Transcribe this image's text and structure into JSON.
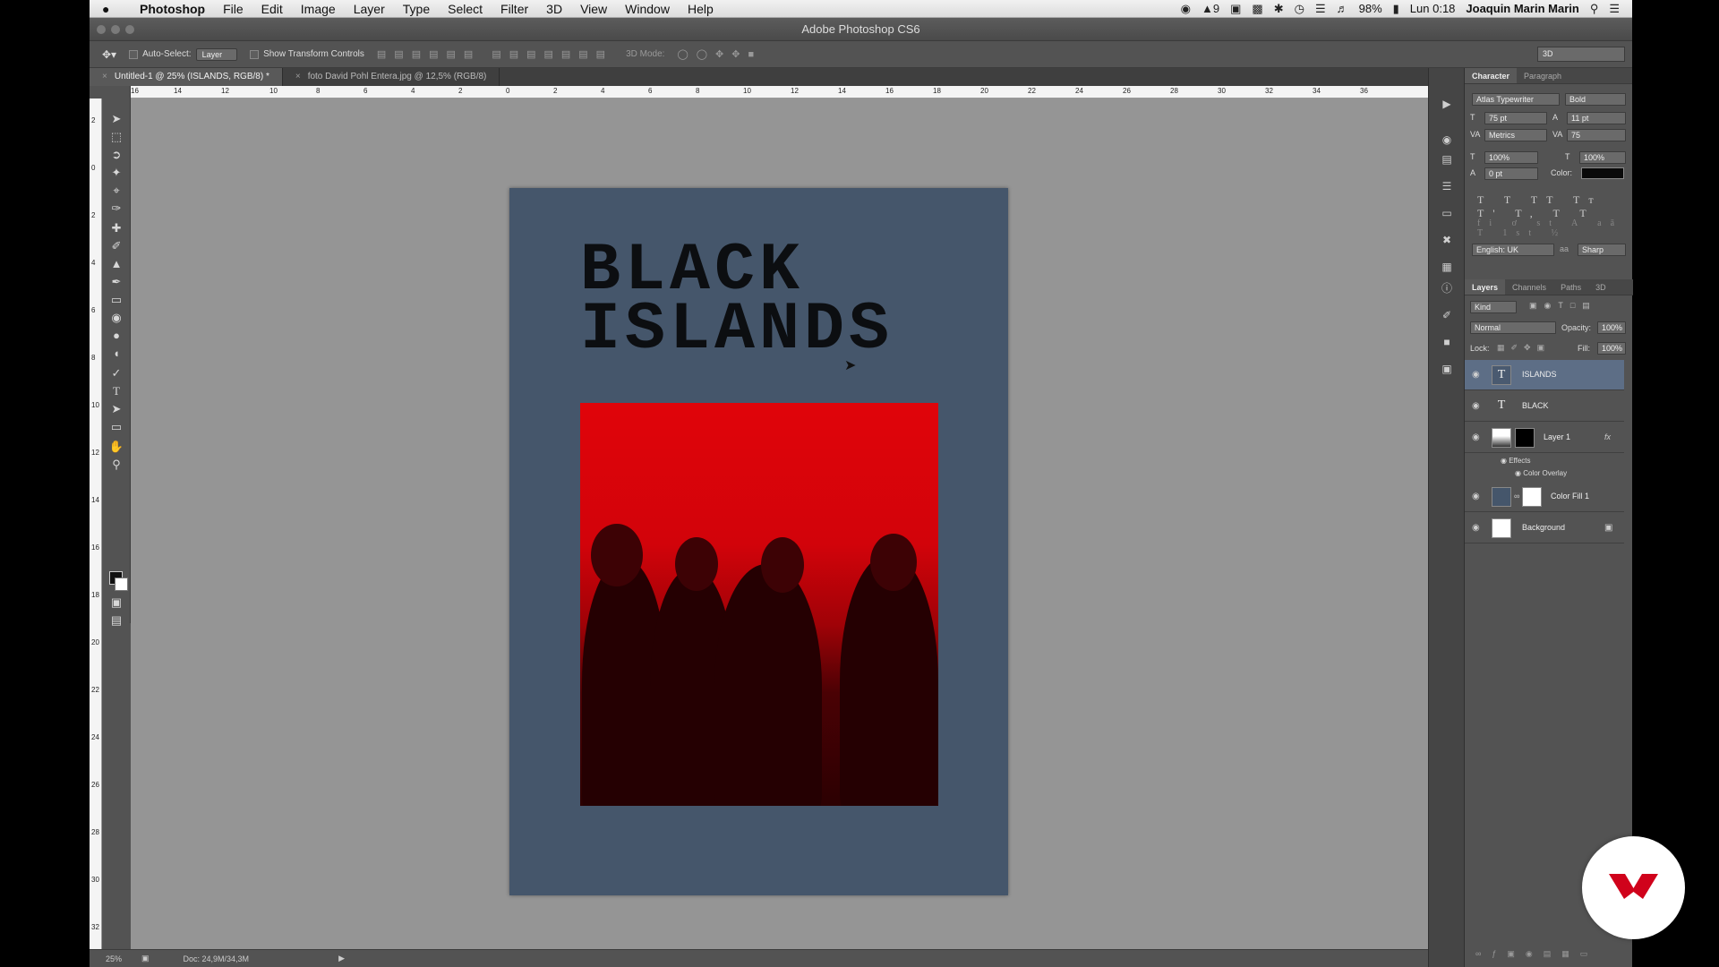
{
  "menubar": {
    "apple": "",
    "app_name": "Photoshop",
    "items": [
      "File",
      "Edit",
      "Image",
      "Layer",
      "Type",
      "Select",
      "Filter",
      "3D",
      "View",
      "Window",
      "Help"
    ],
    "status": {
      "notifications": "9",
      "battery": "98%",
      "clock": "Lun 0:18",
      "user": "Joaquin Marin Marin"
    }
  },
  "window": {
    "title": "Adobe Photoshop CS6"
  },
  "options_bar": {
    "auto_select_label": "Auto-Select:",
    "auto_select_value": "Layer",
    "transform_label": "Show Transform Controls",
    "mode_label": "3D Mode:",
    "workspace": "3D"
  },
  "tabs": [
    {
      "label": "Untitled-1 @ 25% (ISLANDS, RGB/8) *",
      "active": true
    },
    {
      "label": "foto David Pohl Entera.jpg @ 12,5% (RGB/8)",
      "active": false
    }
  ],
  "ruler": {
    "h_labels": [
      "16",
      "14",
      "12",
      "10",
      "8",
      "6",
      "4",
      "2",
      "0",
      "2",
      "4",
      "6",
      "8",
      "10",
      "12",
      "14",
      "16",
      "18",
      "20",
      "22",
      "24",
      "26",
      "28",
      "30",
      "32",
      "34",
      "36"
    ],
    "v_labels": [
      "2",
      "0",
      "2",
      "4",
      "6",
      "8",
      "10",
      "12",
      "14",
      "16",
      "18",
      "20",
      "22",
      "24",
      "26",
      "28",
      "30",
      "32"
    ]
  },
  "document": {
    "headline_line1": "BLACK",
    "headline_line2": "ISLANDS",
    "background_color": "#45566b",
    "photo_tint": "#e0040a"
  },
  "status_bar": {
    "zoom": "25%",
    "doc_size": "Doc: 24,9M/34,3M"
  },
  "character_panel": {
    "tabs": [
      "Character",
      "Paragraph"
    ],
    "font_family": "Atlas Typewriter",
    "font_style": "Bold",
    "font_size": "75 pt",
    "leading": "11 pt",
    "kerning": "Metrics",
    "tracking": "75",
    "vertical_scale": "100%",
    "horizontal_scale": "100%",
    "baseline_shift": "0 pt",
    "color_label": "Color:",
    "type_styles": "T T TT Tт T' T, T T",
    "opentype": "fi ơ st A aā T 1st ½",
    "language": "English: UK",
    "anti_alias": "Sharp",
    "aa_label": "aa"
  },
  "layers_panel": {
    "tabs": [
      "Layers",
      "Channels",
      "Paths",
      "3D"
    ],
    "kind_filter": "Kind",
    "blend_mode": "Normal",
    "opacity_label": "Opacity:",
    "opacity": "100%",
    "lock_label": "Lock:",
    "fill_label": "Fill:",
    "fill": "100%",
    "layers": [
      {
        "name": "ISLANDS",
        "type": "text",
        "selected": true
      },
      {
        "name": "BLACK",
        "type": "text",
        "selected": false
      },
      {
        "name": "Layer 1",
        "type": "image",
        "selected": false
      },
      {
        "name": "Color Fill 1",
        "type": "fill",
        "selected": false
      },
      {
        "name": "Background",
        "type": "background",
        "selected": false
      }
    ],
    "effects_label": "Effects",
    "effect_name": "Color Overlay",
    "fx_mark": "fx"
  },
  "accent_color": "#d0021b"
}
